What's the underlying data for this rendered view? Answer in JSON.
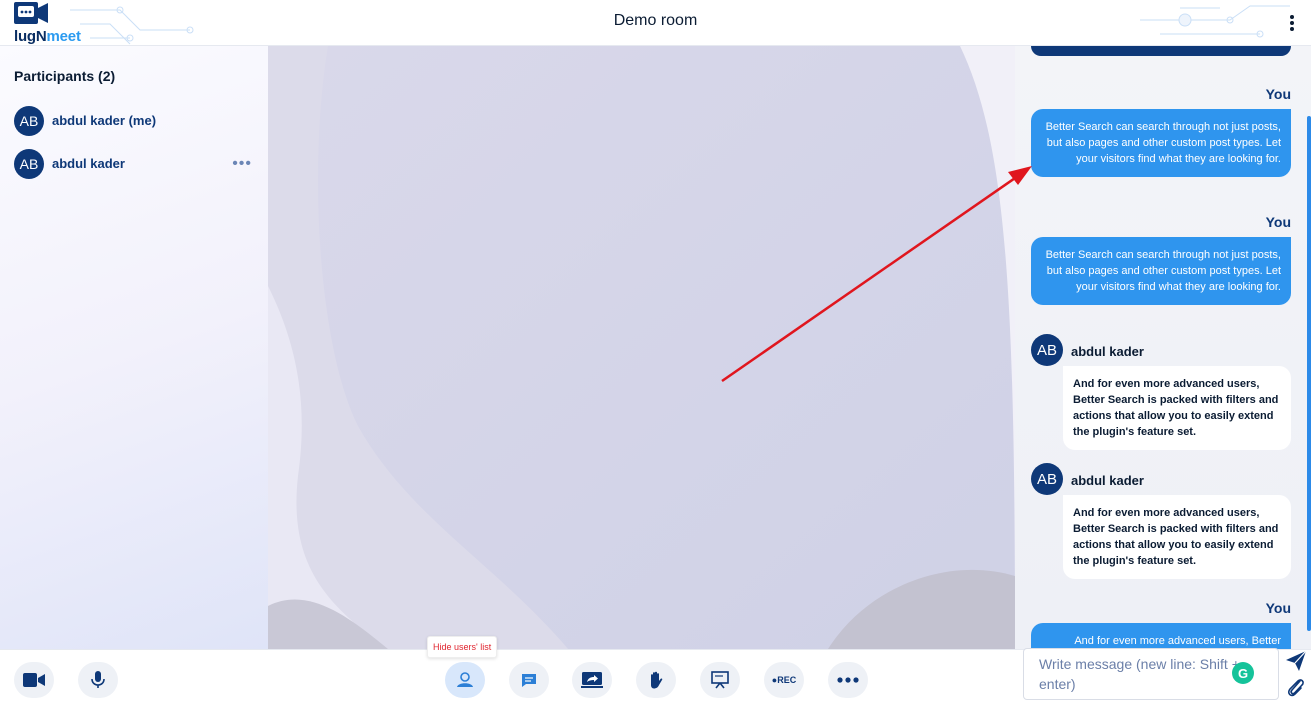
{
  "header": {
    "logo_text_a": "lugN",
    "logo_text_b": "meet",
    "room_title": "Demo room"
  },
  "sidebar": {
    "title": "Participants (2)",
    "participants": [
      {
        "initials": "AB",
        "name": "abdul kader (me)"
      },
      {
        "initials": "AB",
        "name": "abdul kader",
        "menu": "..."
      }
    ]
  },
  "chat": {
    "messages": [
      {
        "from": "You",
        "text": "Better Search can search through not just posts, but also pages and other custom post types. Let your visitors find what they are looking for."
      },
      {
        "from": "You",
        "text": "Better Search can search through not just posts, but also pages and other custom post types. Let your visitors find what they are looking for."
      },
      {
        "from": "abdul kader",
        "initials": "AB",
        "text": "And for even more advanced users, Better Search is packed with filters and actions that allow you to easily extend the plugin's feature set."
      },
      {
        "from": "abdul kader",
        "initials": "AB",
        "text": "And for even more advanced users, Better Search is packed with filters and actions that allow you to easily extend the plugin's feature set."
      },
      {
        "from": "You",
        "text": "And for even more advanced users, Better"
      }
    ],
    "input_placeholder": "Write message (new line: Shift + enter)"
  },
  "footer": {
    "tooltip": "Hide users' list",
    "rec_label": "●REC",
    "buttons": [
      "webcam-icon",
      "microphone-icon",
      "users-icon",
      "chat-icon",
      "screen-share-icon",
      "raise-hand-icon",
      "whiteboard-icon",
      "recording-icon",
      "more-icon"
    ]
  },
  "colors": {
    "primary": "#0e3878",
    "accent": "#2f95ee",
    "annotation_arrow": "#e0161e"
  }
}
